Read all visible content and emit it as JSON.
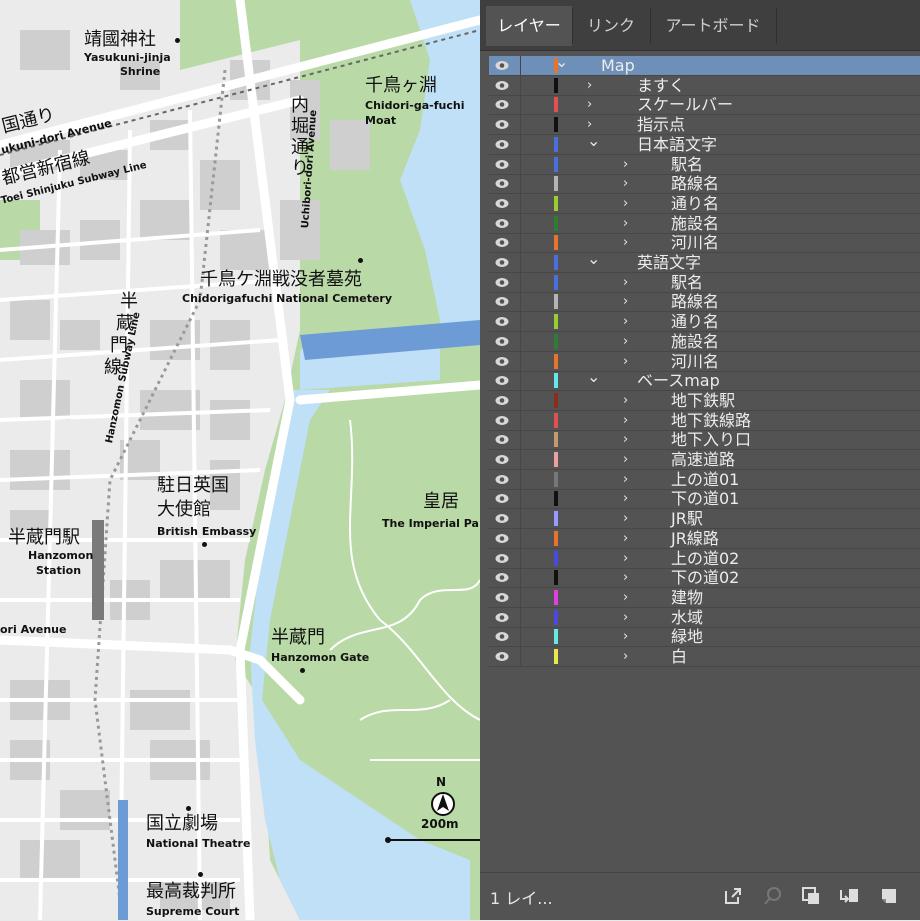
{
  "map": {
    "labels": {
      "yasukuni_jp": "靖國神社",
      "yasukuni_en1": "Yasukuni-jinja",
      "yasukuni_en2": "Shrine",
      "yasukuni_ave_jp": "国通り",
      "yasukuni_ave_en": "ukuni-dori Avenue",
      "toei_jp": "都営新宿線",
      "toei_en": "Toei Shinjuku Subway Line",
      "uchibori_jp1": "内",
      "uchibori_jp2": "堀",
      "uchibori_jp3": "通",
      "uchibori_jp4": "り",
      "uchibori_en": "Uchibori-dori Avenue",
      "chidori_jp": "千鳥ヶ淵",
      "chidori_en1": "Chidori-ga-fuchi",
      "chidori_en2": "Moat",
      "cemetery_jp": "千鳥ケ淵戦没者墓苑",
      "cemetery_en": "Chidorigafuchi National Cemetery",
      "hanzomon_line_jp1": "半",
      "hanzomon_line_jp2": "蔵",
      "hanzomon_line_jp3": "門",
      "hanzomon_line_jp4": "線",
      "hanzomon_line_en": "Hanzomon Subway Line",
      "embassy_jp1": "駐日英国",
      "embassy_jp2": "大使館",
      "embassy_en": "British Embassy",
      "palace_jp": "皇居",
      "palace_en": "The Imperial Pa",
      "station_jp": "半蔵門駅",
      "station_en1": "Hanzomon",
      "station_en2": "Station",
      "shinjuku_ave_en": "ori Avenue",
      "gate_jp": "半蔵門",
      "gate_en": "Hanzomon Gate",
      "theatre_jp": "国立劇場",
      "theatre_en": "National Theatre",
      "court_jp": "最高裁判所",
      "court_en": "Supreme Court",
      "north": "N",
      "scale": "200m"
    }
  },
  "panel": {
    "tabs": [
      "レイヤー",
      "リンク",
      "アートボード"
    ],
    "layers": [
      {
        "name": "Map",
        "depth": 0,
        "expanded": true,
        "color": "#e8742c",
        "selected": true
      },
      {
        "name": "ますく",
        "depth": 1,
        "expanded": false,
        "color": "#111111"
      },
      {
        "name": "スケールバー",
        "depth": 1,
        "expanded": false,
        "color": "#e05252"
      },
      {
        "name": "指示点",
        "depth": 1,
        "expanded": false,
        "color": "#111111"
      },
      {
        "name": "日本語文字",
        "depth": 1,
        "expanded": true,
        "color": "#4a6fe0"
      },
      {
        "name": "駅名",
        "depth": 2,
        "expanded": false,
        "color": "#4a6fe0"
      },
      {
        "name": "路線名",
        "depth": 2,
        "expanded": false,
        "color": "#b4b4b4"
      },
      {
        "name": "通り名",
        "depth": 2,
        "expanded": false,
        "color": "#9acd32"
      },
      {
        "name": "施設名",
        "depth": 2,
        "expanded": false,
        "color": "#2e7d32"
      },
      {
        "name": "河川名",
        "depth": 2,
        "expanded": false,
        "color": "#e8742c"
      },
      {
        "name": "英語文字",
        "depth": 1,
        "expanded": true,
        "color": "#4a6fe0"
      },
      {
        "name": "駅名",
        "depth": 2,
        "expanded": false,
        "color": "#4a6fe0"
      },
      {
        "name": "路線名",
        "depth": 2,
        "expanded": false,
        "color": "#b4b4b4"
      },
      {
        "name": "通り名",
        "depth": 2,
        "expanded": false,
        "color": "#9acd32"
      },
      {
        "name": "施設名",
        "depth": 2,
        "expanded": false,
        "color": "#2e7d32"
      },
      {
        "name": "河川名",
        "depth": 2,
        "expanded": false,
        "color": "#e8742c"
      },
      {
        "name": "ベースmap",
        "depth": 1,
        "expanded": true,
        "color": "#66e8e8"
      },
      {
        "name": "地下鉄駅",
        "depth": 2,
        "expanded": false,
        "color": "#8b2d1a"
      },
      {
        "name": "地下鉄線路",
        "depth": 2,
        "expanded": false,
        "color": "#e05252"
      },
      {
        "name": "地下入り口",
        "depth": 2,
        "expanded": false,
        "color": "#c49a6c"
      },
      {
        "name": "高速道路",
        "depth": 2,
        "expanded": false,
        "color": "#e8a0a0"
      },
      {
        "name": "上の道01",
        "depth": 2,
        "expanded": false,
        "color": "#777777"
      },
      {
        "name": "下の道01",
        "depth": 2,
        "expanded": false,
        "color": "#111111"
      },
      {
        "name": "JR駅",
        "depth": 2,
        "expanded": false,
        "color": "#9a9aff"
      },
      {
        "name": "JR線路",
        "depth": 2,
        "expanded": false,
        "color": "#e8742c"
      },
      {
        "name": "上の道02",
        "depth": 2,
        "expanded": false,
        "color": "#4a4ae0"
      },
      {
        "name": "下の道02",
        "depth": 2,
        "expanded": false,
        "color": "#111111"
      },
      {
        "name": "建物",
        "depth": 2,
        "expanded": false,
        "color": "#e040e0"
      },
      {
        "name": "水域",
        "depth": 2,
        "expanded": false,
        "color": "#4a4ae0"
      },
      {
        "name": "緑地",
        "depth": 2,
        "expanded": false,
        "color": "#66e8e8"
      },
      {
        "name": "白",
        "depth": 2,
        "expanded": false,
        "color": "#e8e84a"
      }
    ],
    "footer": {
      "count": "1 レイ..."
    }
  }
}
